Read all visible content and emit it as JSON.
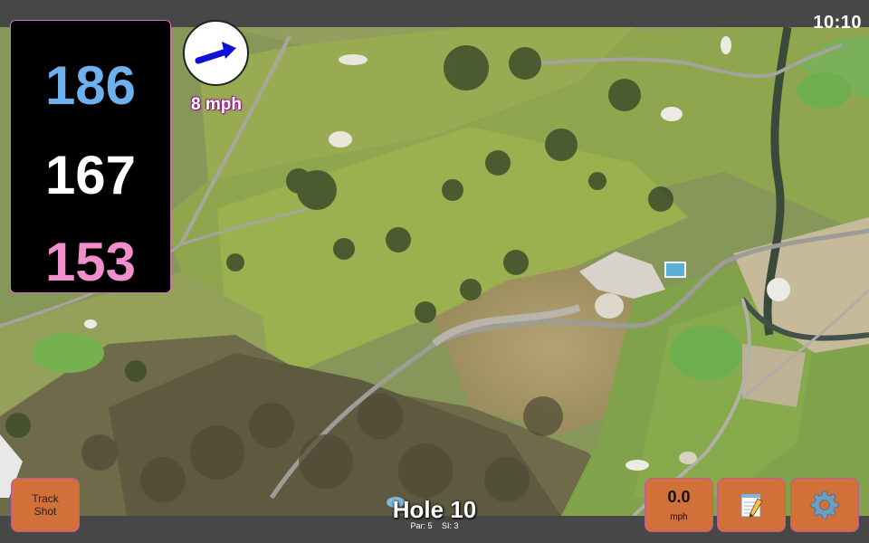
{
  "status_bar": {
    "time": "10:10"
  },
  "distances": {
    "back": {
      "value": "186",
      "color": "#6fb0ee"
    },
    "middle": {
      "value": "167",
      "color": "#ffffff"
    },
    "front": {
      "value": "153",
      "color": "#f08fcb"
    }
  },
  "wind": {
    "speed_label": "8 mph",
    "arrow_color": "#1010d8",
    "icon": "wind-direction-arrow-icon"
  },
  "buttons": {
    "track_shot_line1": "Track",
    "track_shot_line2": "Shot",
    "speed_value": "0.0",
    "speed_unit": "mph",
    "notes_icon": "notepad-icon",
    "settings_icon": "gear-icon",
    "accent_color": "#d2703a"
  },
  "hole": {
    "title": "Hole 10",
    "par_label": "Par: 5",
    "si_label": "SI: 3"
  },
  "map": {
    "type": "satellite-aerial-view"
  }
}
